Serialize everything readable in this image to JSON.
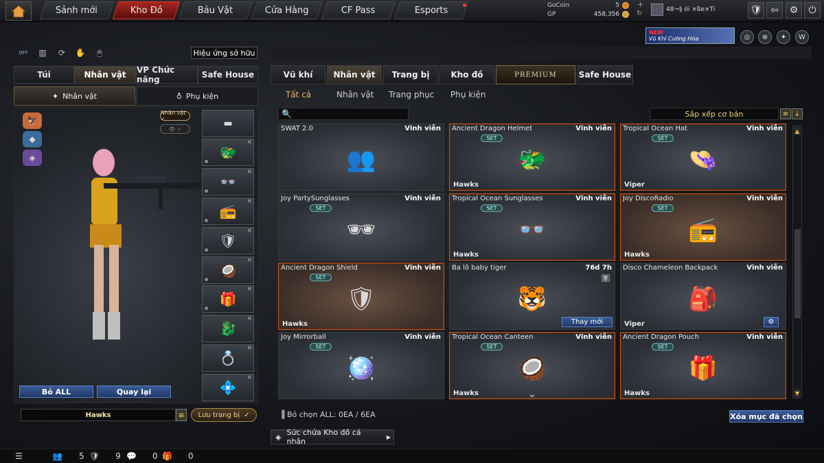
{
  "nav": {
    "tabs": [
      "Sảnh mới",
      "Kho Đồ",
      "Bảu Vật",
      "Cửa Hàng",
      "CF Pass",
      "Esports"
    ],
    "active": "Kho Đồ"
  },
  "currency": {
    "gocoin_label": "GoCoin",
    "gocoin_value": "5",
    "gp_label": "GP",
    "gp_value": "458,356",
    "player_name": "48¬§ ói ×ße×Ti"
  },
  "promo": {
    "new": "NEW",
    "text": "Vũ Khí Cường Hóa"
  },
  "left": {
    "off_label": "OFF",
    "effect_button": "Hiệu ứng sở hữu",
    "tabs": [
      "Túi",
      "Nhân vật",
      "VP Chức năng",
      "Safe House"
    ],
    "subtabs": [
      "Nhân vật",
      "Phụ kiện"
    ],
    "nv_badge": "Nhân vật ✓",
    "reset_all": "Bỏ ALL",
    "back": "Quay lại",
    "preset_name": "Hawks",
    "save": "Lưu trang bị"
  },
  "right": {
    "tabs": [
      "Vũ khí",
      "Nhân vật",
      "Trang bị",
      "Kho đồ",
      "PREMIUM",
      "Safe House"
    ],
    "subtabs": [
      "Tất cả",
      "Nhân vật",
      "Trang phục",
      "Phụ kiện"
    ],
    "sort_label": "Sắp xếp cơ bản",
    "selection_info": "Bỏ chọn ALL: 0EA / 6EA",
    "clear_button": "Xóa mục đã chọn",
    "storage_label": "Sức chứa Kho đồ cá nhân",
    "items": [
      {
        "name": "SWAT 2.0",
        "duration": "Vĩnh viễn",
        "set": false,
        "team": "",
        "style": "plain",
        "art": "👥"
      },
      {
        "name": "Ancient Dragon Helmet",
        "duration": "Vĩnh viễn",
        "set": true,
        "team": "Hawks",
        "style": "orange",
        "art": "🐲"
      },
      {
        "name": "Tropical Ocean Hat",
        "duration": "Vĩnh viễn",
        "set": true,
        "team": "Viper",
        "style": "orange",
        "art": "👒"
      },
      {
        "name": "Joy PartySunglasses",
        "duration": "Vĩnh viễn",
        "set": true,
        "team": "",
        "style": "plain",
        "art": "🕶"
      },
      {
        "name": "Tropical Ocean Sunglasses",
        "duration": "Vĩnh viễn",
        "set": true,
        "team": "Hawks",
        "style": "orange",
        "art": "👓"
      },
      {
        "name": "Joy DiscoRadio",
        "duration": "Vĩnh viễn",
        "set": true,
        "team": "Hawks",
        "style": "orange-brown",
        "art": "📻"
      },
      {
        "name": "Ancient Dragon Shield",
        "duration": "Vĩnh viễn",
        "set": true,
        "team": "Hawks",
        "style": "orange-brown",
        "art": "🛡"
      },
      {
        "name": "Ba lô baby tiger",
        "duration": "76d 7h",
        "set": false,
        "team": "",
        "style": "plain",
        "art": "🐯",
        "action": "Thay mới"
      },
      {
        "name": "Disco Chameleon Backpack",
        "duration": "Vĩnh viễn",
        "set": false,
        "team": "Viper",
        "style": "plain",
        "art": "🎒",
        "gear": true
      },
      {
        "name": "Joy Mirrorball",
        "duration": "Vĩnh viễn",
        "set": true,
        "team": "",
        "style": "plain",
        "art": "🪩"
      },
      {
        "name": "Tropical Ocean Canteen",
        "duration": "Vĩnh viễn",
        "set": true,
        "team": "Hawks",
        "style": "orange",
        "art": "🥥",
        "chevron": true
      },
      {
        "name": "Ancient Dragon Pouch",
        "duration": "Vĩnh viễn",
        "set": true,
        "team": "Hawks",
        "style": "orange",
        "art": "🎁"
      }
    ],
    "set_label": "SET"
  },
  "status_bar": {
    "count1": "5",
    "count2": "9",
    "count3": "0",
    "count4": "0"
  }
}
